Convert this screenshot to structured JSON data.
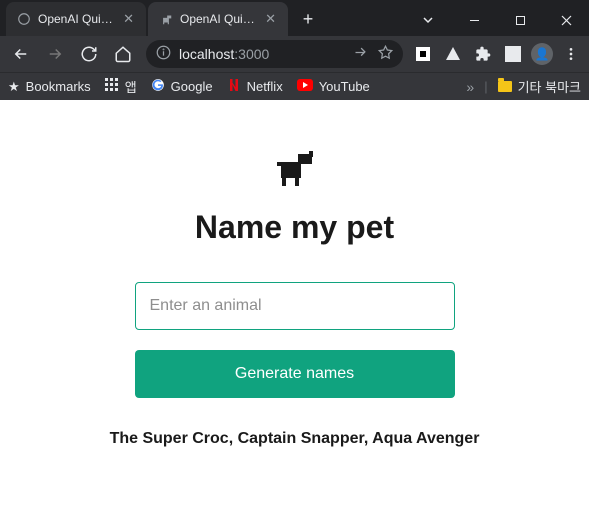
{
  "window": {
    "tabs": [
      {
        "title": "OpenAI Quicksta",
        "active": false
      },
      {
        "title": "OpenAI Quicksta",
        "active": true
      }
    ]
  },
  "toolbar": {
    "url_host": "localhost",
    "url_port": ":3000"
  },
  "bookmarks": {
    "label": "Bookmarks",
    "items": [
      {
        "label": "앱"
      },
      {
        "label": "Google"
      },
      {
        "label": "Netflix"
      },
      {
        "label": "YouTube"
      }
    ],
    "other_label": "기타 북마크"
  },
  "page": {
    "title": "Name my pet",
    "input_placeholder": "Enter an animal",
    "input_value": "",
    "button_label": "Generate names",
    "result": "The Super Croc, Captain Snapper, Aqua Avenger"
  },
  "colors": {
    "accent": "#10a37f"
  }
}
